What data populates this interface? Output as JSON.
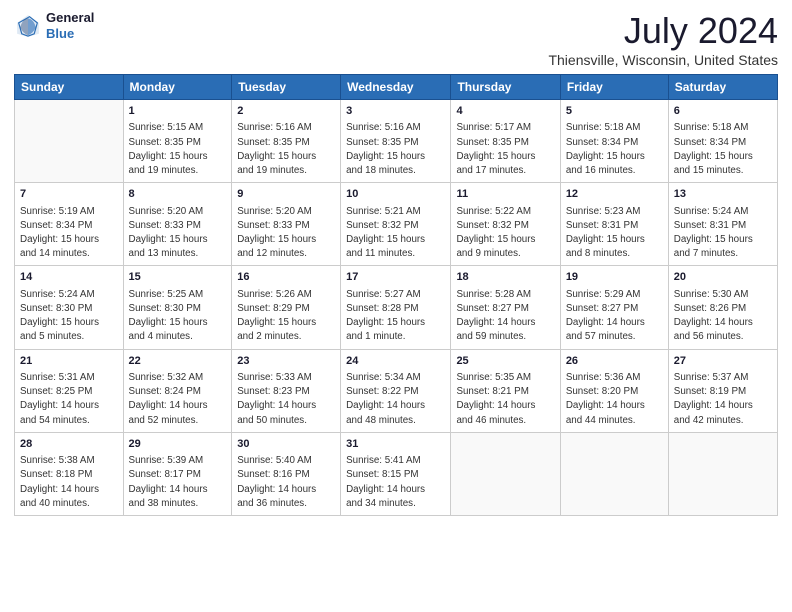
{
  "header": {
    "logo": {
      "general": "General",
      "blue": "Blue"
    },
    "title": "July 2024",
    "subtitle": "Thiensville, Wisconsin, United States"
  },
  "calendar": {
    "days_of_week": [
      "Sunday",
      "Monday",
      "Tuesday",
      "Wednesday",
      "Thursday",
      "Friday",
      "Saturday"
    ],
    "weeks": [
      [
        {
          "day": "",
          "info": ""
        },
        {
          "day": "1",
          "info": "Sunrise: 5:15 AM\nSunset: 8:35 PM\nDaylight: 15 hours\nand 19 minutes."
        },
        {
          "day": "2",
          "info": "Sunrise: 5:16 AM\nSunset: 8:35 PM\nDaylight: 15 hours\nand 19 minutes."
        },
        {
          "day": "3",
          "info": "Sunrise: 5:16 AM\nSunset: 8:35 PM\nDaylight: 15 hours\nand 18 minutes."
        },
        {
          "day": "4",
          "info": "Sunrise: 5:17 AM\nSunset: 8:35 PM\nDaylight: 15 hours\nand 17 minutes."
        },
        {
          "day": "5",
          "info": "Sunrise: 5:18 AM\nSunset: 8:34 PM\nDaylight: 15 hours\nand 16 minutes."
        },
        {
          "day": "6",
          "info": "Sunrise: 5:18 AM\nSunset: 8:34 PM\nDaylight: 15 hours\nand 15 minutes."
        }
      ],
      [
        {
          "day": "7",
          "info": "Sunrise: 5:19 AM\nSunset: 8:34 PM\nDaylight: 15 hours\nand 14 minutes."
        },
        {
          "day": "8",
          "info": "Sunrise: 5:20 AM\nSunset: 8:33 PM\nDaylight: 15 hours\nand 13 minutes."
        },
        {
          "day": "9",
          "info": "Sunrise: 5:20 AM\nSunset: 8:33 PM\nDaylight: 15 hours\nand 12 minutes."
        },
        {
          "day": "10",
          "info": "Sunrise: 5:21 AM\nSunset: 8:32 PM\nDaylight: 15 hours\nand 11 minutes."
        },
        {
          "day": "11",
          "info": "Sunrise: 5:22 AM\nSunset: 8:32 PM\nDaylight: 15 hours\nand 9 minutes."
        },
        {
          "day": "12",
          "info": "Sunrise: 5:23 AM\nSunset: 8:31 PM\nDaylight: 15 hours\nand 8 minutes."
        },
        {
          "day": "13",
          "info": "Sunrise: 5:24 AM\nSunset: 8:31 PM\nDaylight: 15 hours\nand 7 minutes."
        }
      ],
      [
        {
          "day": "14",
          "info": "Sunrise: 5:24 AM\nSunset: 8:30 PM\nDaylight: 15 hours\nand 5 minutes."
        },
        {
          "day": "15",
          "info": "Sunrise: 5:25 AM\nSunset: 8:30 PM\nDaylight: 15 hours\nand 4 minutes."
        },
        {
          "day": "16",
          "info": "Sunrise: 5:26 AM\nSunset: 8:29 PM\nDaylight: 15 hours\nand 2 minutes."
        },
        {
          "day": "17",
          "info": "Sunrise: 5:27 AM\nSunset: 8:28 PM\nDaylight: 15 hours\nand 1 minute."
        },
        {
          "day": "18",
          "info": "Sunrise: 5:28 AM\nSunset: 8:27 PM\nDaylight: 14 hours\nand 59 minutes."
        },
        {
          "day": "19",
          "info": "Sunrise: 5:29 AM\nSunset: 8:27 PM\nDaylight: 14 hours\nand 57 minutes."
        },
        {
          "day": "20",
          "info": "Sunrise: 5:30 AM\nSunset: 8:26 PM\nDaylight: 14 hours\nand 56 minutes."
        }
      ],
      [
        {
          "day": "21",
          "info": "Sunrise: 5:31 AM\nSunset: 8:25 PM\nDaylight: 14 hours\nand 54 minutes."
        },
        {
          "day": "22",
          "info": "Sunrise: 5:32 AM\nSunset: 8:24 PM\nDaylight: 14 hours\nand 52 minutes."
        },
        {
          "day": "23",
          "info": "Sunrise: 5:33 AM\nSunset: 8:23 PM\nDaylight: 14 hours\nand 50 minutes."
        },
        {
          "day": "24",
          "info": "Sunrise: 5:34 AM\nSunset: 8:22 PM\nDaylight: 14 hours\nand 48 minutes."
        },
        {
          "day": "25",
          "info": "Sunrise: 5:35 AM\nSunset: 8:21 PM\nDaylight: 14 hours\nand 46 minutes."
        },
        {
          "day": "26",
          "info": "Sunrise: 5:36 AM\nSunset: 8:20 PM\nDaylight: 14 hours\nand 44 minutes."
        },
        {
          "day": "27",
          "info": "Sunrise: 5:37 AM\nSunset: 8:19 PM\nDaylight: 14 hours\nand 42 minutes."
        }
      ],
      [
        {
          "day": "28",
          "info": "Sunrise: 5:38 AM\nSunset: 8:18 PM\nDaylight: 14 hours\nand 40 minutes."
        },
        {
          "day": "29",
          "info": "Sunrise: 5:39 AM\nSunset: 8:17 PM\nDaylight: 14 hours\nand 38 minutes."
        },
        {
          "day": "30",
          "info": "Sunrise: 5:40 AM\nSunset: 8:16 PM\nDaylight: 14 hours\nand 36 minutes."
        },
        {
          "day": "31",
          "info": "Sunrise: 5:41 AM\nSunset: 8:15 PM\nDaylight: 14 hours\nand 34 minutes."
        },
        {
          "day": "",
          "info": ""
        },
        {
          "day": "",
          "info": ""
        },
        {
          "day": "",
          "info": ""
        }
      ]
    ]
  }
}
